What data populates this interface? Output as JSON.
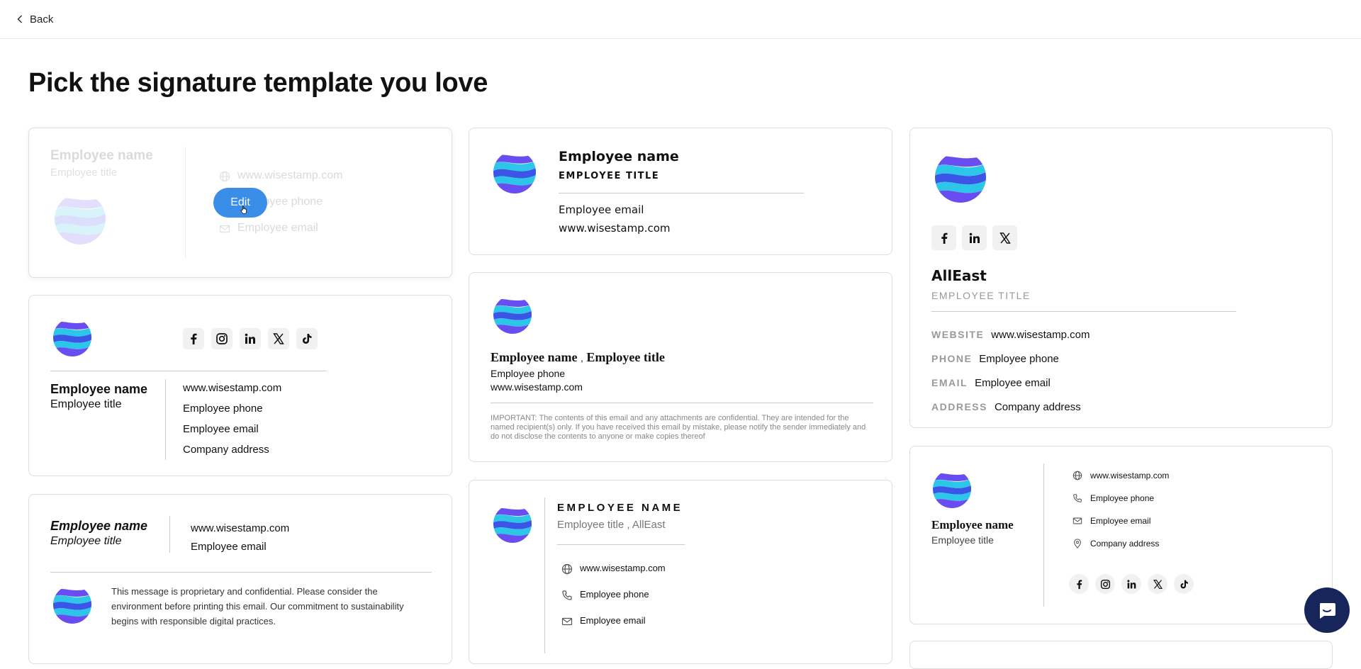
{
  "nav": {
    "back_label": "Back"
  },
  "page": {
    "title": "Pick the signature template you love"
  },
  "colors": {
    "edit_button": "#3b8ee8",
    "chat_button": "#17265a",
    "logo_a": "#3b55e6",
    "logo_b": "#2cc6e8"
  },
  "t1": {
    "name": "Employee name",
    "title": "Employee title",
    "website": "www.wisestamp.com",
    "phone": "Employee phone",
    "email": "Employee email",
    "edit_label": "Edit"
  },
  "t2": {
    "name": "Employee name",
    "title": "EMPLOYEE TITLE",
    "email": "Employee email",
    "website": "www.wisestamp.com"
  },
  "t3": {
    "company": "AllEast",
    "title": "EMPLOYEE TITLE",
    "rows": [
      {
        "label": "WEBSITE",
        "value": "www.wisestamp.com"
      },
      {
        "label": "PHONE",
        "value": "Employee phone"
      },
      {
        "label": "EMAIL",
        "value": "Employee email"
      },
      {
        "label": "ADDRESS",
        "value": "Company address"
      }
    ]
  },
  "t4": {
    "name": "Employee name",
    "title": "Employee title",
    "website": "www.wisestamp.com",
    "phone": "Employee phone",
    "email": "Employee email",
    "address": "Company address"
  },
  "t5": {
    "name": "Employee name",
    "separator": ",",
    "title": "Employee title",
    "phone": "Employee phone",
    "website": "www.wisestamp.com",
    "disclaimer": "IMPORTANT: The contents of this email and any attachments are confidential. They are intended for the named recipient(s) only. If you have received this email by mistake, please notify the sender immediately and do not disclose the contents to anyone or make copies thereof"
  },
  "t6": {
    "name": "Employee name",
    "title": "Employee title",
    "website": "www.wisestamp.com",
    "phone": "Employee phone",
    "email": "Employee email",
    "address": "Company address"
  },
  "t7": {
    "name": "Employee name",
    "title": "Employee title",
    "website": "www.wisestamp.com",
    "email": "Employee email",
    "disclaimer": "This message is proprietary and confidential. Please consider the environment before printing this email. Our commitment to sustainability begins with responsible digital practices."
  },
  "t8": {
    "name": "EMPLOYEE NAME",
    "title_line": "Employee title , AllEast",
    "website": "www.wisestamp.com",
    "phone": "Employee phone",
    "email": "Employee email"
  }
}
